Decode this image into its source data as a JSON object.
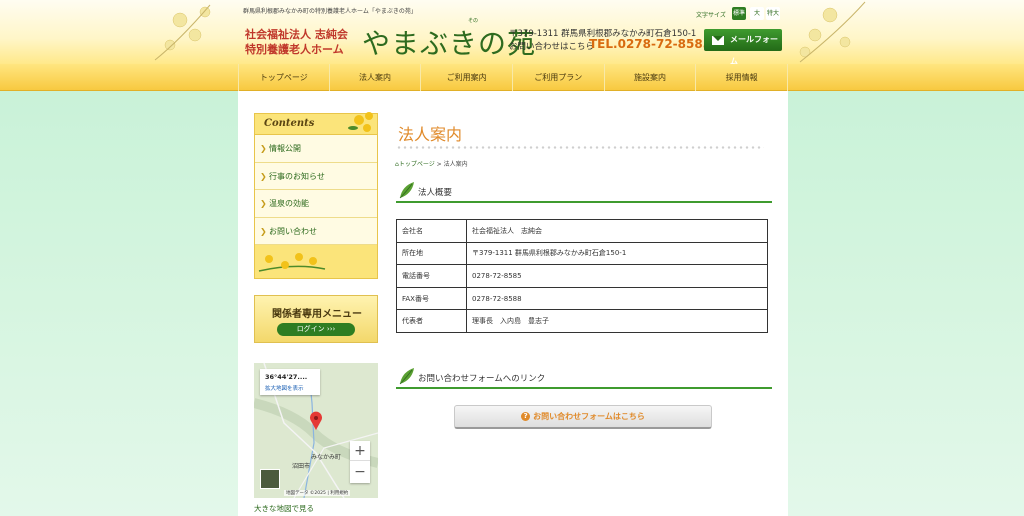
{
  "header": {
    "tagline": "群馬県利根郡みなかみ町の特別養護老人ホーム「やまぶきの苑」",
    "corp_line1": "社会福祉法人 志純会",
    "corp_line2": "特別養護老人ホーム",
    "logo": "やまぶきの苑",
    "logo_ruby": "その",
    "address": "〒379-1311 群馬県利根郡みなかみ町石倉150-1",
    "contact_label": "お問い合わせはこちら",
    "tel": "TEL.0278-72-8585",
    "font_size_label": "文字サイズ",
    "font_sizes": [
      "標準",
      "大",
      "特大"
    ],
    "mailform_label": "メールフォーム"
  },
  "nav": {
    "items": [
      "トップページ",
      "法人案内",
      "ご利用案内",
      "ご利用プラン",
      "施設案内",
      "採用情報"
    ]
  },
  "sidebar": {
    "contents_title": "Contents",
    "items": [
      "情報公開",
      "行事のお知らせ",
      "温泉の効能",
      "お問い合わせ"
    ],
    "member_title": "関係者専用メニュー",
    "login_label": "ログイン ›››",
    "map": {
      "coord": "36°44'27....",
      "enlarge": "拡大地図を表示",
      "town": "みなかみ町",
      "city": "沼田市",
      "credit": "地図データ ©2025 | 利用規約",
      "zoom_in": "+",
      "zoom_out": "−"
    },
    "bigmap_link": "大きな地図で見る"
  },
  "main": {
    "page_title": "法人案内",
    "breadcrumb": {
      "home": "トップページ",
      "sep": ">",
      "current": "法人案内"
    },
    "section1_title": "法人概要",
    "table": [
      {
        "key": "会社名",
        "value": "社会福祉法人　志純会"
      },
      {
        "key": "所在地",
        "value": "〒379-1311 群馬県利根郡みなかみ町石倉150-1"
      },
      {
        "key": "電話番号",
        "value": "0278-72-8585"
      },
      {
        "key": "FAX番号",
        "value": "0278-72-8588"
      },
      {
        "key": "代表者",
        "value": "理事長　入内島　豊志子"
      }
    ],
    "section2_title": "お問い合わせフォームへのリンク",
    "contact_button": "お問い合わせフォームはこちら"
  },
  "colors": {
    "accent_green": "#2e7d22",
    "accent_orange": "#e08a2a",
    "nav_yellow": "#f8c940"
  }
}
